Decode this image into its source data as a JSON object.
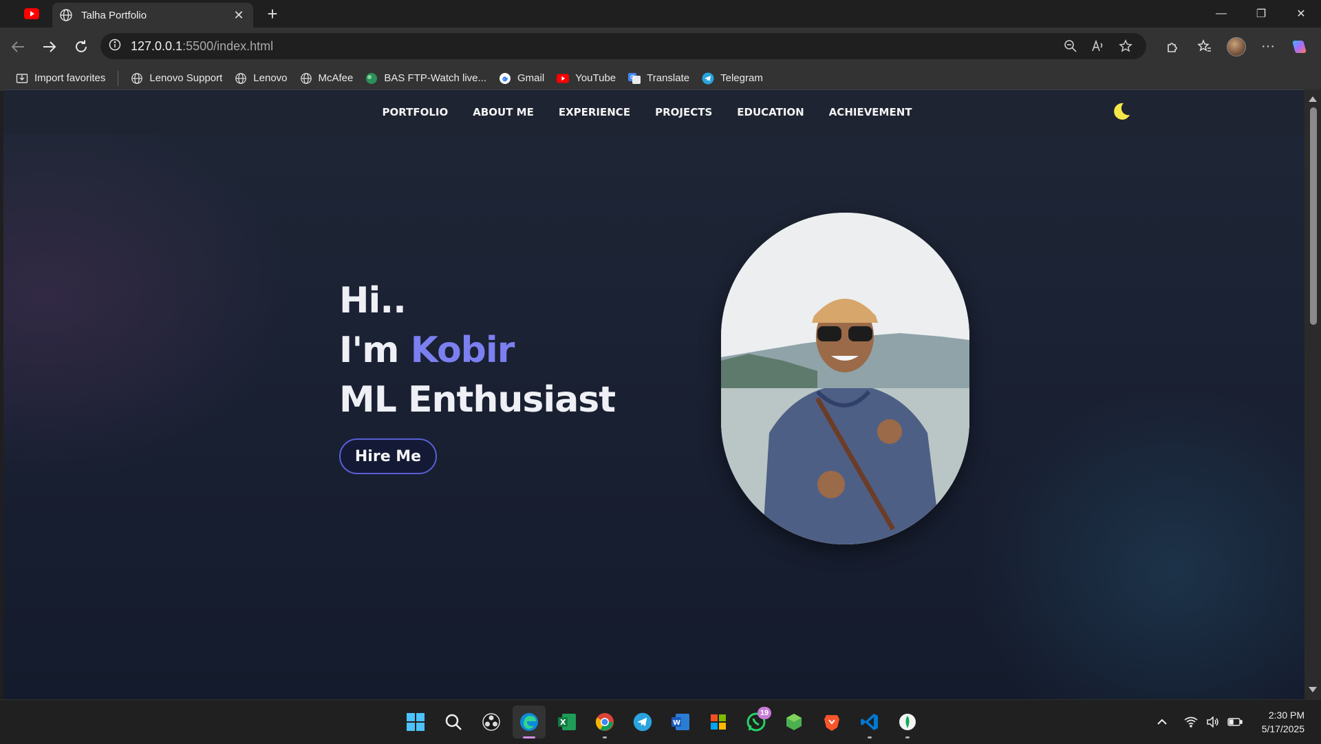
{
  "browser": {
    "tab_title": "Talha Portfolio",
    "url_host": "127.0.0.1",
    "url_rest": ":5500/index.html"
  },
  "bookmarks": [
    {
      "label": "Import favorites",
      "icon": "import-icon"
    },
    {
      "label": "Lenovo Support",
      "icon": "globe-icon"
    },
    {
      "label": "Lenovo",
      "icon": "globe-icon"
    },
    {
      "label": "McAfee",
      "icon": "globe-icon"
    },
    {
      "label": "BAS FTP-Watch live...",
      "icon": "bas-icon"
    },
    {
      "label": "Gmail",
      "icon": "google-icon"
    },
    {
      "label": "YouTube",
      "icon": "youtube-icon"
    },
    {
      "label": "Translate",
      "icon": "translate-icon"
    },
    {
      "label": "Telegram",
      "icon": "telegram-icon"
    }
  ],
  "site": {
    "nav": [
      "PORTFOLIO",
      "ABOUT ME",
      "EXPERIENCE",
      "PROJECTS",
      "EDUCATION",
      "ACHIEVEMENT"
    ],
    "hero": {
      "line1": "Hi..",
      "line2_prefix": "I'm",
      "line2_name": "Kobir",
      "line3": "ML Enthusiast",
      "button": "Hire Me"
    },
    "accent_color": "#7b7ff0"
  },
  "taskbar": {
    "whatsapp_badge": "19",
    "time": "2:30 PM",
    "date": "5/17/2025"
  }
}
